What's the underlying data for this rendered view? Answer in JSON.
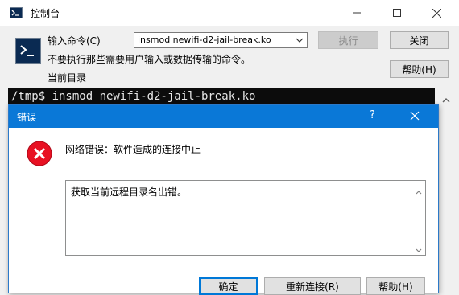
{
  "window": {
    "title": "控制台",
    "title_icon": "console-window-icon",
    "controls": {
      "minimize_icon": "minimize-icon",
      "maximize_icon": "maximize-icon",
      "close_icon": "close-icon"
    }
  },
  "console": {
    "command_label": "输入命令(C)",
    "command_value": "insmod newifi-d2-jail-break.ko",
    "warning_text": "不要执行那些需要用户输入或数据传输的命令。",
    "current_dir_label": "当前目录",
    "buttons": {
      "execute": "执行",
      "close": "关闭",
      "help": "帮助(H)"
    },
    "execute_enabled": false
  },
  "terminal": {
    "line": "/tmp$ insmod newifi-d2-jail-break.ko",
    "background": "#0c0c0c",
    "foreground": "#e8e8e8"
  },
  "error_dialog": {
    "title": "错误",
    "help_glyph": "?",
    "title_bar_color": "#0a78d7",
    "icon": "error-icon",
    "message": "网络错误：软件造成的连接中止",
    "detail": "获取当前远程目录名出错。",
    "buttons": {
      "ok": "确定",
      "reconnect": "重新连接(R)",
      "help": "帮助(H)"
    }
  }
}
